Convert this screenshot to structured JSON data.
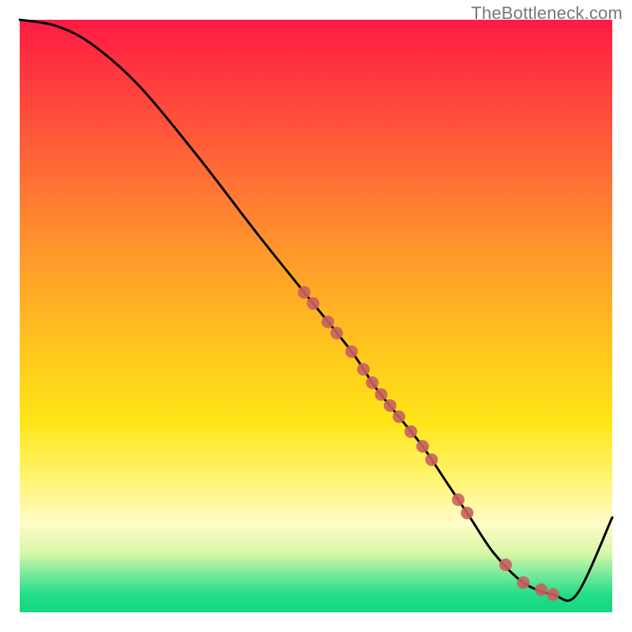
{
  "watermark": "TheBottleneck.com",
  "chart_data": {
    "type": "line",
    "title": "",
    "xlabel": "",
    "ylabel": "",
    "xlim": [
      0,
      100
    ],
    "ylim": [
      0,
      100
    ],
    "series": [
      {
        "name": "curve",
        "x": [
          0,
          6,
          12,
          20,
          30,
          40,
          48,
          56,
          60,
          64,
          68,
          72,
          76,
          80,
          85,
          90,
          94,
          100
        ],
        "y": [
          100,
          99,
          96,
          89,
          77,
          64,
          54,
          44,
          38,
          33,
          28,
          22,
          16,
          10,
          5,
          3,
          3,
          16
        ]
      }
    ],
    "scatter_on_curve": {
      "name": "points",
      "color": "#c9605f",
      "x": [
        48,
        49.5,
        52,
        53.5,
        56,
        58,
        59.5,
        61,
        62.5,
        64,
        66,
        68,
        69.5,
        74,
        75.5,
        82,
        85,
        88,
        90
      ]
    },
    "background_gradient": {
      "top": "#ff1a44",
      "mid": "#ffe618",
      "bottom": "#14d77d"
    }
  }
}
